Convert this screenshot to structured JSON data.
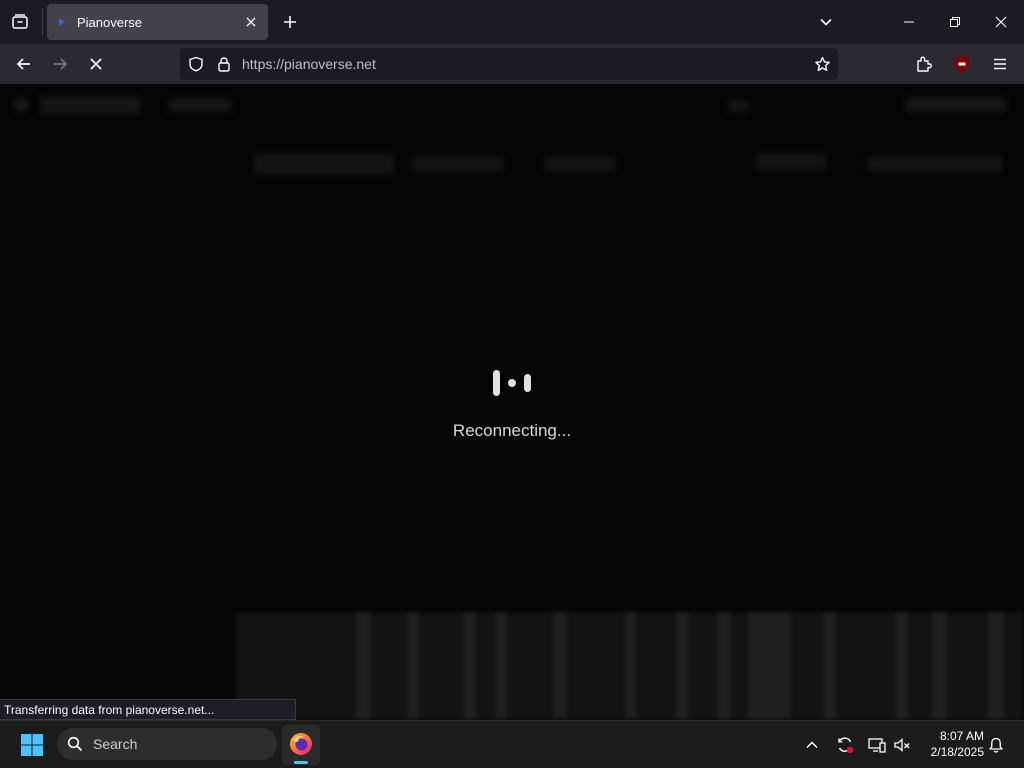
{
  "browser": {
    "tab": {
      "title": "Pianoverse"
    },
    "address": {
      "url": "https://pianoverse.net"
    }
  },
  "page": {
    "overlay": {
      "message": "Reconnecting..."
    }
  },
  "status_bar": {
    "text": "Transferring data from pianoverse.net..."
  },
  "taskbar": {
    "search": {
      "label": "Search"
    },
    "clock": {
      "time": "8:07 AM",
      "date": "2/18/2025"
    }
  },
  "colors": {
    "chrome_dark": "#1c1b22",
    "chrome": "#2b2a33",
    "page_background": "#050505",
    "taskbar": "#1c1c1c",
    "accent": "#4cc2ff"
  },
  "icons": [
    "tab-list-icon",
    "close-icon",
    "plus-icon",
    "chevron-down-icon",
    "minimize-icon",
    "restore-icon",
    "back-arrow-icon",
    "forward-arrow-icon",
    "stop-icon",
    "shield-icon",
    "lock-icon",
    "star-icon",
    "extensions-icon",
    "ublock-icon",
    "menu-icon",
    "windows-logo-icon",
    "search-icon",
    "firefox-icon",
    "chevron-up-icon",
    "sync-icon",
    "network-icon",
    "volume-muted-icon",
    "bell-icon"
  ]
}
